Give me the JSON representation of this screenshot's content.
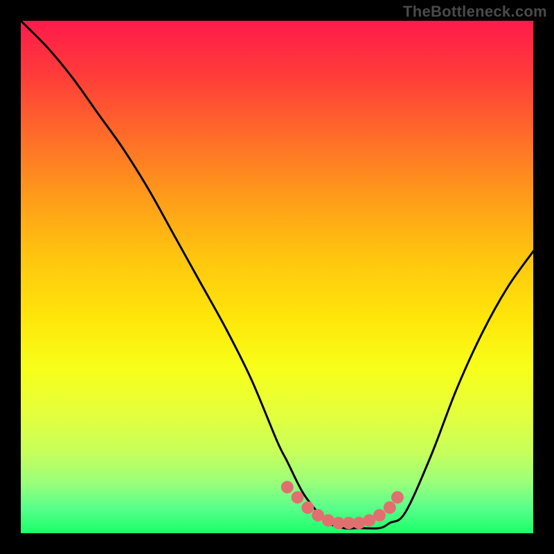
{
  "watermark": "TheBottleneck.com",
  "colors": {
    "background": "#000000",
    "curve": "#000000",
    "markers": "#e07070",
    "watermark": "#4a4a4a"
  },
  "chart_data": {
    "type": "line",
    "title": "",
    "xlabel": "",
    "ylabel": "",
    "xlim": [
      0,
      100
    ],
    "ylim": [
      0,
      100
    ],
    "grid": false,
    "legend": false,
    "series": [
      {
        "name": "bottleneck-curve",
        "x": [
          0,
          5,
          10,
          15,
          20,
          25,
          30,
          35,
          40,
          45,
          50,
          52,
          55,
          58,
          60,
          63,
          66,
          70,
          72,
          75,
          80,
          85,
          90,
          95,
          100
        ],
        "values": [
          100,
          95,
          89,
          82,
          75,
          67,
          58,
          49,
          40,
          30,
          18,
          14,
          8,
          4,
          2,
          1,
          1,
          1,
          2,
          4,
          15,
          28,
          39,
          48,
          55
        ]
      }
    ],
    "markers": {
      "name": "highlight-dots",
      "x": [
        52,
        54,
        56,
        58,
        60,
        62,
        64,
        66,
        68,
        70,
        72,
        73.5
      ],
      "values": [
        9,
        7,
        5,
        3.5,
        2.5,
        2,
        2,
        2,
        2.5,
        3.5,
        5,
        7
      ]
    },
    "background_gradient": {
      "orientation": "vertical",
      "stops": [
        {
          "pos": 0.0,
          "color": "#ff1a4b"
        },
        {
          "pos": 0.1,
          "color": "#ff3a3a"
        },
        {
          "pos": 0.22,
          "color": "#ff6a2a"
        },
        {
          "pos": 0.34,
          "color": "#ff9a1a"
        },
        {
          "pos": 0.46,
          "color": "#ffc50f"
        },
        {
          "pos": 0.58,
          "color": "#ffe60a"
        },
        {
          "pos": 0.68,
          "color": "#f7ff1a"
        },
        {
          "pos": 0.76,
          "color": "#e6ff3a"
        },
        {
          "pos": 0.84,
          "color": "#c8ff5a"
        },
        {
          "pos": 0.9,
          "color": "#9cff7a"
        },
        {
          "pos": 0.95,
          "color": "#5aff8a"
        },
        {
          "pos": 1.0,
          "color": "#1aff6a"
        }
      ]
    }
  }
}
